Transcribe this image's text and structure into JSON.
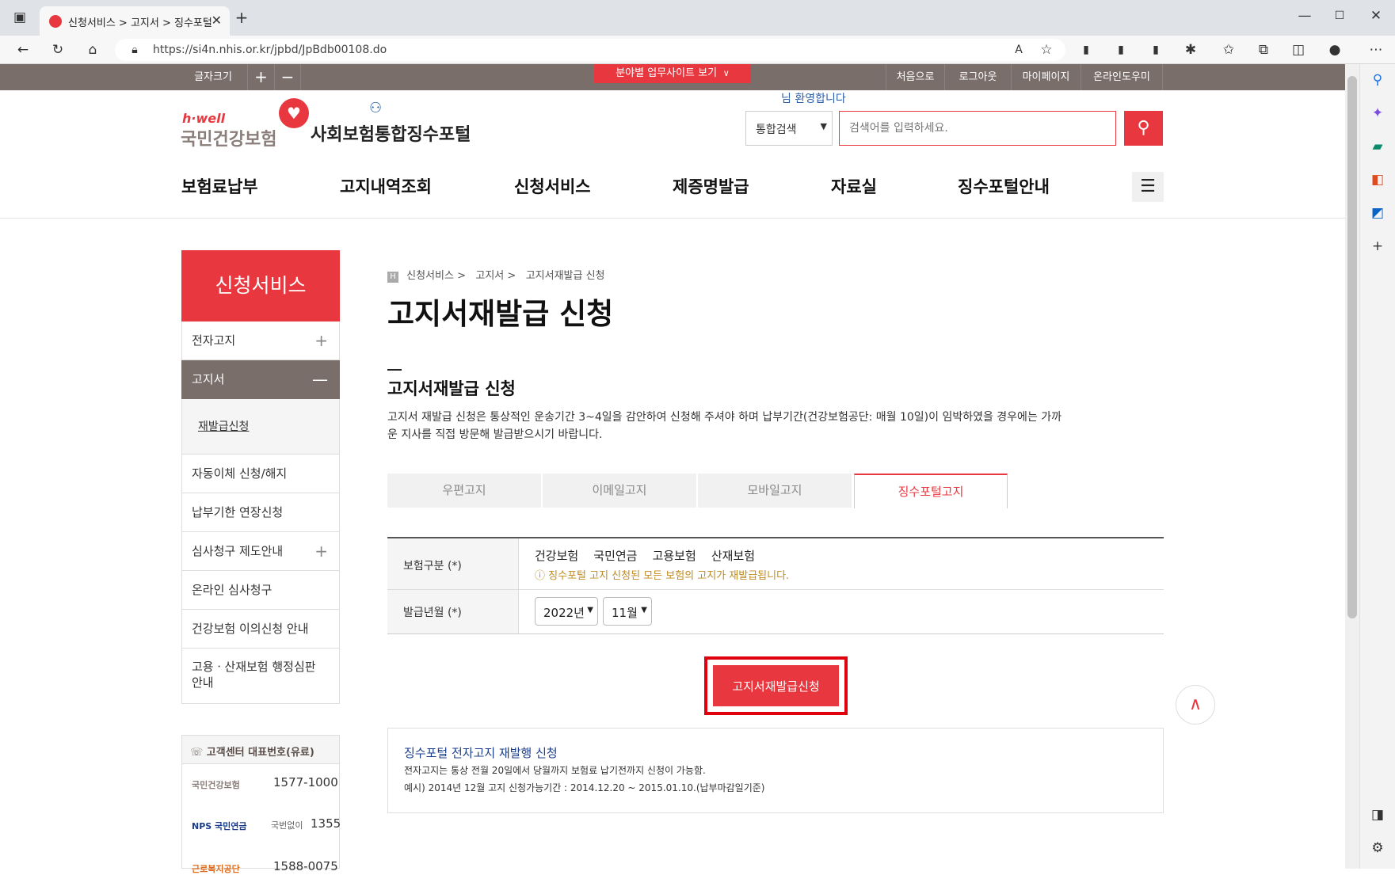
{
  "browser": {
    "tab_title": "신청서비스 > 고지서 > 징수포털",
    "url": "https://si4n.nhis.or.kr/jpbd/JpBdb00108.do"
  },
  "topbar": {
    "font_size_label": "글자크기",
    "plus": "+",
    "minus": "−",
    "field_sites": "분야별 업무사이트 보기",
    "links": [
      "처음으로",
      "로그아웃",
      "마이페이지",
      "온라인도우미"
    ]
  },
  "header": {
    "logo_hwell": "h·well",
    "logo_nhis": "국민건강보험",
    "portal_title": "사회보험통합징수포털",
    "welcome": "님 환영합니다",
    "search_scope": "통합검색",
    "search_placeholder": "검색어를 입력하세요."
  },
  "gnb": [
    "보험료납부",
    "고지내역조회",
    "신청서비스",
    "제증명발급",
    "자료실",
    "징수포털안내"
  ],
  "lnb": {
    "title": "신청서비스",
    "items": [
      "전자고지",
      "고지서",
      "재발급신청",
      "자동이체 신청/해지",
      "납부기한 연장신청",
      "심사청구 제도안내",
      "온라인 심사청구",
      "건강보험 이의신청 안내",
      "고용ㆍ산재보험 행정심판 안내"
    ]
  },
  "breadcrumb": {
    "home": "H",
    "items": [
      "신청서비스 >",
      "고지서 >",
      "고지서재발급 신청"
    ]
  },
  "page_title": "고지서재발급 신청",
  "section": {
    "title": "고지서재발급 신청",
    "desc_line1": "고지서 재발급 신청은 통상적인 운송기간 3~4일을 감안하여 신청해 주셔야 하며 납부기간(건강보험공단: 매월 10일)이 임박하였을 경우에는 가까",
    "desc_line2": "운 지사를 직접 방문해 발급받으시기 바랍니다."
  },
  "tabs": [
    "우편고지",
    "이메일고지",
    "모바일고지",
    "징수포털고지"
  ],
  "form": {
    "insurance_label": "보험구분 (*)",
    "insurance_types": [
      "건강보험",
      "국민연금",
      "고용보험",
      "산재보험"
    ],
    "insurance_note": "징수포털 고지 신청된 모든 보험의 고지가 재발급됩니다.",
    "month_label": "발급년월 (*)",
    "year_value": "2022년",
    "month_value": "11월"
  },
  "submit_label": "고지서재발급신청",
  "info": {
    "title": "징수포털 전자고지 재발행 신청",
    "line1": "전자고지는 통상 전월 20일에서 당월까지 보험료 납기전까지 신청이 가능함.",
    "line2": "예시) 2014년 12월 고지 신청가능기간 : 2014.12.20 ~ 2015.01.10.(납부마감일기준)"
  },
  "customer_center": {
    "title": "고객센터 대표번호(유료)",
    "rows": [
      {
        "org": "국민건강보험",
        "prefix": "",
        "number": "1577-1000"
      },
      {
        "org": "NPS 국민연금",
        "prefix": "국번없이",
        "number": "1355"
      },
      {
        "org": "근로복지공단",
        "prefix": "",
        "number": "1588-0075"
      }
    ]
  },
  "colors": {
    "accent": "#e8373f",
    "topbar": "#7a6e6b",
    "lnb_active": "#7a6e6b"
  }
}
